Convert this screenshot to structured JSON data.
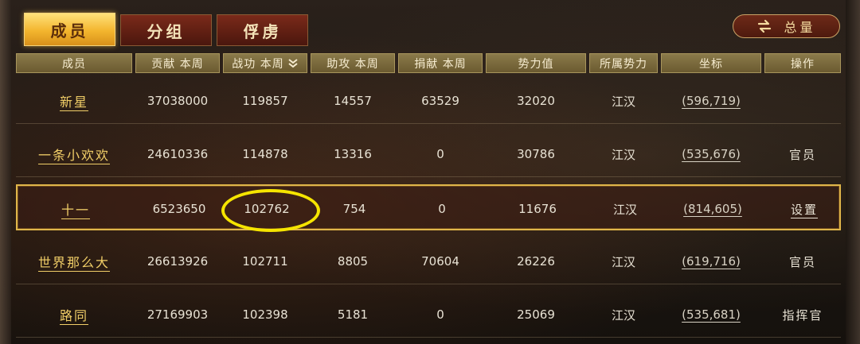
{
  "tabs": [
    {
      "label": "成员",
      "active": true
    },
    {
      "label": "分组",
      "active": false
    },
    {
      "label": "俘虏",
      "active": false
    }
  ],
  "summary_button": {
    "label": "总量",
    "icon": "swap-arrows-icon"
  },
  "columns": [
    {
      "key": "member",
      "label": "成员"
    },
    {
      "key": "contribution",
      "label": "贡献 本周"
    },
    {
      "key": "merit",
      "label": "战功 本周",
      "sort_icon": "double-chevron-down-icon"
    },
    {
      "key": "assist",
      "label": "助攻 本周"
    },
    {
      "key": "donation",
      "label": "捐献 本周"
    },
    {
      "key": "power",
      "label": "势力值"
    },
    {
      "key": "faction",
      "label": "所属势力"
    },
    {
      "key": "coords",
      "label": "坐标"
    },
    {
      "key": "action",
      "label": "操作"
    }
  ],
  "rows": [
    {
      "name": "新星",
      "contribution": "37038000",
      "merit": "119857",
      "assist": "14557",
      "donation": "63529",
      "power": "32020",
      "faction": "江汉",
      "coords": "(596,719)",
      "action": ""
    },
    {
      "name": "一条小欢欢",
      "contribution": "24610336",
      "merit": "114878",
      "assist": "13316",
      "donation": "0",
      "power": "30786",
      "faction": "江汉",
      "coords": "(535,676)",
      "action": "官员"
    },
    {
      "name": "十一",
      "contribution": "6523650",
      "merit": "102762",
      "assist": "754",
      "donation": "0",
      "power": "11676",
      "faction": "江汉",
      "coords": "(814,605)",
      "action": "设置",
      "highlighted": true
    },
    {
      "name": "世界那么大",
      "contribution": "26613926",
      "merit": "102711",
      "assist": "8805",
      "donation": "70604",
      "power": "26226",
      "faction": "江汉",
      "coords": "(619,716)",
      "action": "官员"
    },
    {
      "name": "路同",
      "contribution": "27169903",
      "merit": "102398",
      "assist": "5181",
      "donation": "0",
      "power": "25069",
      "faction": "江汉",
      "coords": "(535,681)",
      "action": "指挥官"
    }
  ],
  "colors": {
    "accent_gold": "#f2cf68",
    "highlight_border": "#e0b64a",
    "annotation_circle": "#f5e400"
  }
}
